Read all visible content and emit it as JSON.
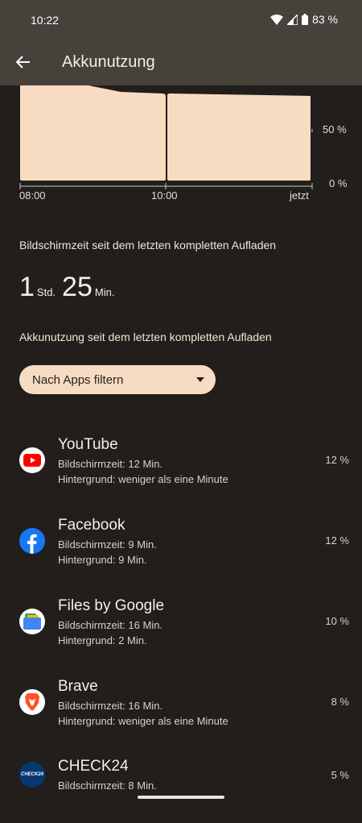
{
  "status": {
    "time": "10:22",
    "battery": "83 %"
  },
  "header": {
    "title": "Akkunutzung"
  },
  "chart_data": {
    "type": "area",
    "x_ticks": [
      "08:00",
      "10:00",
      "jetzt"
    ],
    "y_ticks": [
      "50 %",
      "0 %"
    ],
    "ylim": [
      0,
      100
    ]
  },
  "screen_time": {
    "label": "Bildschirmzeit seit dem letzten kompletten Aufladen",
    "hours": "1",
    "hours_unit": "Std.",
    "minutes": "25",
    "minutes_unit": "Min."
  },
  "battery_usage": {
    "label": "Akkunutzung seit dem letzten kompletten Aufladen",
    "filter_label": "Nach Apps filtern"
  },
  "apps": [
    {
      "name": "YouTube",
      "screen": "Bildschirmzeit: 12 Min.",
      "background": "Hintergrund: weniger als eine Minute",
      "percent": "12 %",
      "icon": "youtube-icon"
    },
    {
      "name": "Facebook",
      "screen": "Bildschirmzeit: 9 Min.",
      "background": "Hintergrund: 9 Min.",
      "percent": "12 %",
      "icon": "facebook-icon"
    },
    {
      "name": "Files by Google",
      "screen": "Bildschirmzeit: 16 Min.",
      "background": "Hintergrund: 2 Min.",
      "percent": "10 %",
      "icon": "files-icon"
    },
    {
      "name": "Brave",
      "screen": "Bildschirmzeit: 16 Min.",
      "background": "Hintergrund: weniger als eine Minute",
      "percent": "8 %",
      "icon": "brave-icon"
    },
    {
      "name": "CHECK24",
      "screen": "Bildschirmzeit: 8 Min.",
      "background": "",
      "percent": "5 %",
      "icon": "check24-icon",
      "icon_text": "CHECK24"
    }
  ],
  "colors": {
    "accent": "#f6dcc2",
    "background": "#221e1b",
    "app_bar": "#47413c"
  }
}
